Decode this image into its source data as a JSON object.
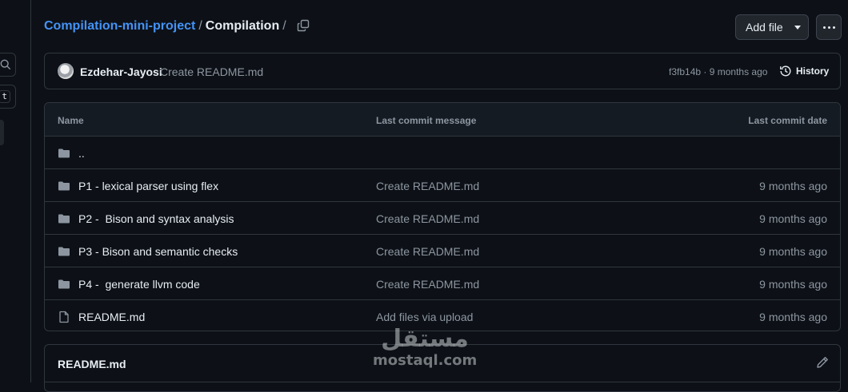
{
  "breadcrumb": {
    "repo": "Compilation-mini-project",
    "separator": "/",
    "current": "Compilation",
    "trailing_separator": "/"
  },
  "toolbar": {
    "add_file_label": "Add file"
  },
  "left_rail": {
    "kbd_hint": "t"
  },
  "latest_commit": {
    "author": "Ezdehar-Jayosi",
    "message": "Create README.md",
    "sha": "f3fb14b",
    "separator": "·",
    "time": "9 months ago",
    "history_label": "History"
  },
  "table": {
    "columns": {
      "name": "Name",
      "message": "Last commit message",
      "date": "Last commit date"
    },
    "rows": [
      {
        "type": "folder",
        "name": "..",
        "message": "",
        "date": ""
      },
      {
        "type": "folder",
        "name": "P1 - lexical parser using flex",
        "message": "Create README.md",
        "date": "9 months ago"
      },
      {
        "type": "folder",
        "name": "P2 -  Bison and syntax analysis",
        "message": "Create README.md",
        "date": "9 months ago"
      },
      {
        "type": "folder",
        "name": "P3 - Bison and semantic checks",
        "message": "Create README.md",
        "date": "9 months ago"
      },
      {
        "type": "folder",
        "name": "P4 -  generate llvm code",
        "message": "Create README.md",
        "date": "9 months ago"
      },
      {
        "type": "file",
        "name": "README.md",
        "message": "Add files via upload",
        "date": "9 months ago"
      }
    ]
  },
  "readme": {
    "title": "README.md"
  },
  "watermark": {
    "arabic": "مستقل",
    "latin": "mostaql.com"
  },
  "colors": {
    "background": "#0d1117",
    "link": "#4493f8",
    "muted": "#8d96a0",
    "border": "#30363d"
  }
}
